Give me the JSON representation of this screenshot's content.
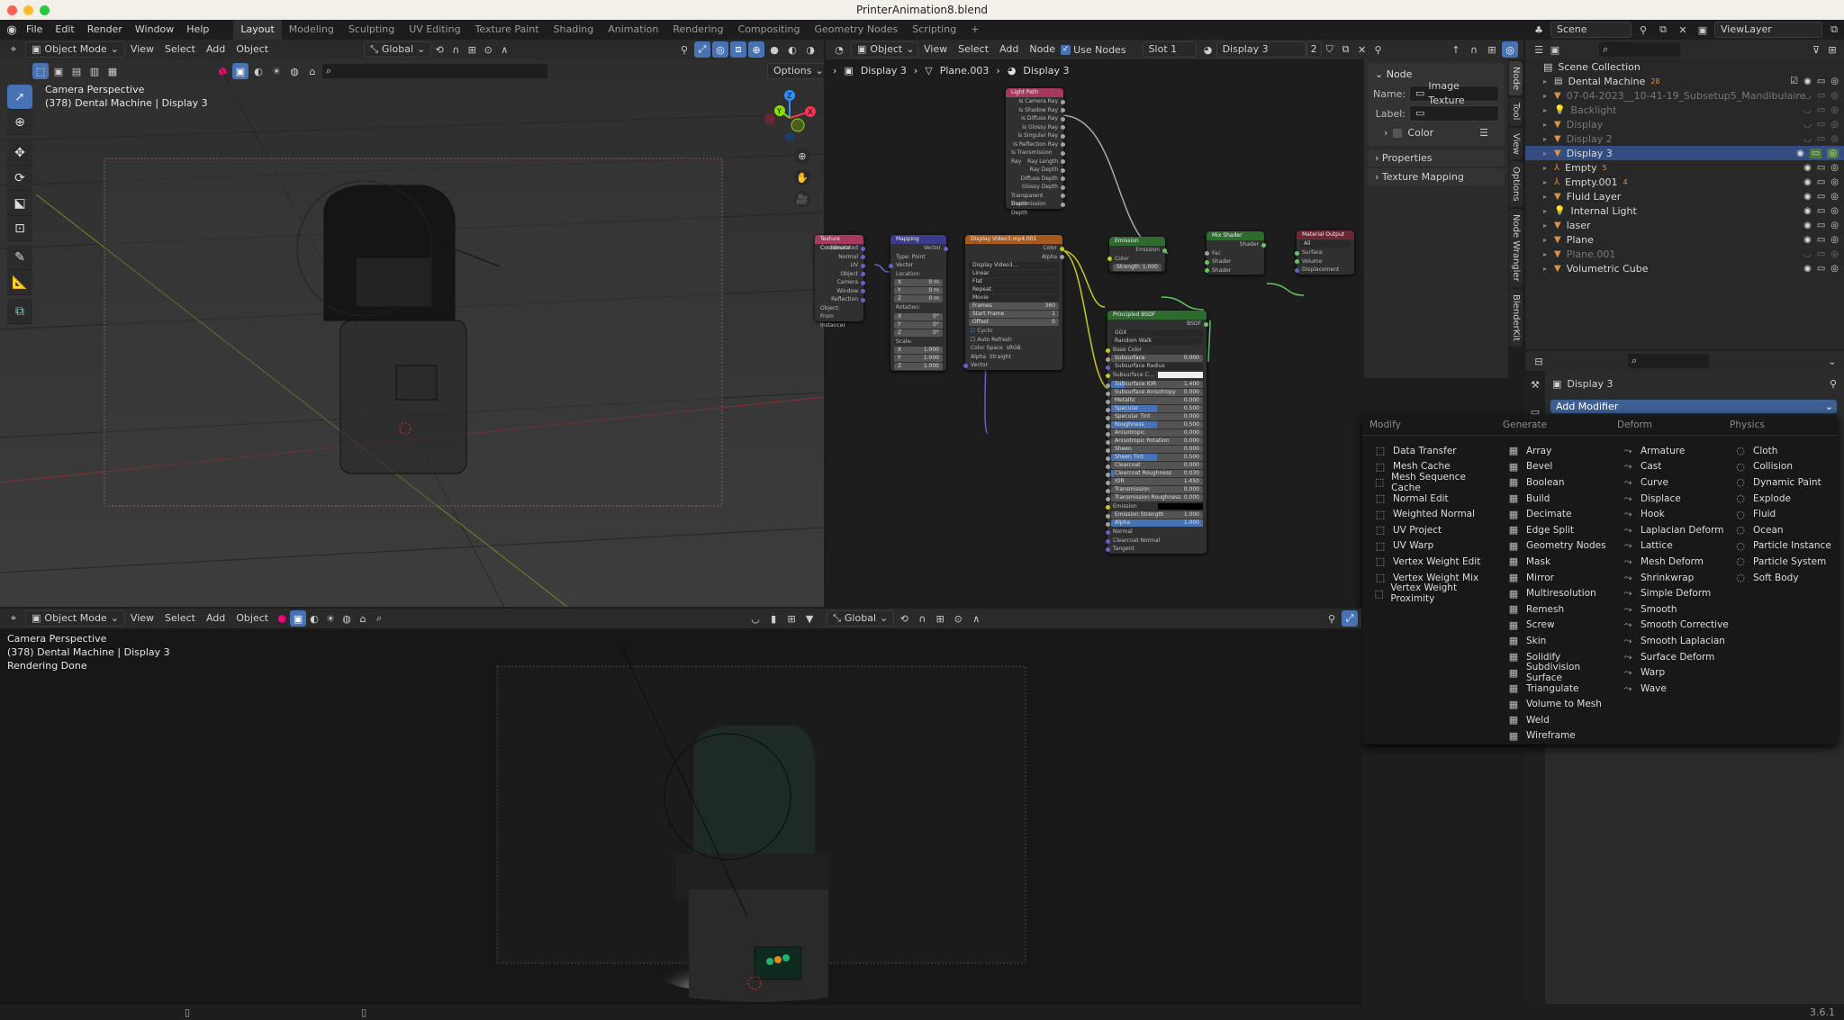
{
  "window": {
    "title": "PrinterAnimation8.blend",
    "version": "3.6.1"
  },
  "menubar": [
    "File",
    "Edit",
    "Render",
    "Window",
    "Help"
  ],
  "workspaces": [
    {
      "label": "Layout",
      "active": true
    },
    {
      "label": "Modeling"
    },
    {
      "label": "Sculpting"
    },
    {
      "label": "UV Editing"
    },
    {
      "label": "Texture Paint"
    },
    {
      "label": "Shading"
    },
    {
      "label": "Animation"
    },
    {
      "label": "Rendering"
    },
    {
      "label": "Compositing"
    },
    {
      "label": "Geometry Nodes"
    },
    {
      "label": "Scripting"
    },
    {
      "label": "+"
    }
  ],
  "scene": {
    "name": "Scene",
    "view_layer": "ViewLayer"
  },
  "viewport_top": {
    "mode": "Object Mode",
    "menus": [
      "View",
      "Select",
      "Add",
      "Object"
    ],
    "orientation": "Global",
    "options": "Options",
    "overlay_lines": [
      "Camera Perspective",
      "(378) Dental Machine | Display 3"
    ],
    "gizmo_axes": [
      "X",
      "Y",
      "Z"
    ]
  },
  "viewport_bottom": {
    "mode": "Object Mode",
    "menus": [
      "View",
      "Select",
      "Add",
      "Object"
    ],
    "orientation": "Global",
    "overlay_lines": [
      "Camera Perspective",
      "(378) Dental Machine | Display 3",
      "Rendering Done"
    ]
  },
  "node_editor": {
    "type": "Object",
    "menus": [
      "View",
      "Select",
      "Add",
      "Node"
    ],
    "use_nodes_label": "Use Nodes",
    "use_nodes": true,
    "slot": "Slot 1",
    "material": "Display 3",
    "users": "2",
    "breadcrumb": [
      "Display 3",
      "Plane.003",
      "Display 3"
    ],
    "nodes": {
      "light_path": {
        "title": "Light Path",
        "outputs": [
          "Is Camera Ray",
          "Is Shadow Ray",
          "Is Diffuse Ray",
          "Is Glossy Ray",
          "Is Singular Ray",
          "Is Reflection Ray",
          "Is Transmission Ray",
          "Ray Length",
          "Ray Depth",
          "Diffuse Depth",
          "Glossy Depth",
          "Transparent Depth",
          "Transmission Depth"
        ]
      },
      "tex_coord": {
        "title": "Texture Coordinate",
        "outputs": [
          "Generated",
          "Normal",
          "UV",
          "Object",
          "Camera",
          "Window",
          "Reflection"
        ],
        "object_label": "Object:",
        "from_instancer": "From Instancer"
      },
      "mapping": {
        "title": "Mapping",
        "output": "Vector",
        "type_label": "Type:",
        "type": "Point",
        "vector": "Vector",
        "location": "Location:",
        "loc": [
          [
            "X",
            "0 m"
          ],
          [
            "Y",
            "0 m"
          ],
          [
            "Z",
            "0 m"
          ]
        ],
        "rotation": "Rotation:",
        "rot": [
          [
            "X",
            "0°"
          ],
          [
            "Y",
            "0°"
          ],
          [
            "Z",
            "0°"
          ]
        ],
        "scale": "Scale:",
        "scl": [
          [
            "X",
            "1.000"
          ],
          [
            "Y",
            "1.000"
          ],
          [
            "Z",
            "1.000"
          ]
        ]
      },
      "image": {
        "title": "Display Video3.mp4.001",
        "outputs": [
          "Color",
          "Alpha"
        ],
        "image": "Display Video3...",
        "interp": "Linear",
        "proj": "Flat",
        "ext": "Repeat",
        "source": "Movie",
        "frames": [
          "Frames",
          "360"
        ],
        "start": [
          "Start Frame",
          "1"
        ],
        "offset": [
          "Offset",
          "0"
        ],
        "cyclic": "Cyclic",
        "auto_refresh": "Auto Refresh",
        "color_space_label": "Color Space",
        "color_space": "sRGB",
        "alpha_label": "Alpha",
        "alpha": "Straight",
        "vector": "Vector"
      },
      "emission": {
        "title": "Emission",
        "output": "Emission",
        "color": "Color",
        "strength": [
          "Strength",
          "1.000"
        ]
      },
      "mix": {
        "title": "Mix Shader",
        "output": "Shader",
        "inputs": [
          "Fac",
          "Shader",
          "Shader"
        ]
      },
      "output": {
        "title": "Material Output",
        "target": "All",
        "inputs": [
          "Surface",
          "Volume",
          "Displacement"
        ]
      },
      "bsdf": {
        "title": "Principled BSDF",
        "output": "BSDF",
        "dist": "GGX",
        "sss": "Random Walk",
        "rows": [
          {
            "label": "Base Color",
            "kind": "socket"
          },
          {
            "label": "Subsurface",
            "value": "0.000",
            "fill": 0
          },
          {
            "label": "Subsurface Radius",
            "kind": "select"
          },
          {
            "label": "Subsurface C...",
            "kind": "color-white"
          },
          {
            "label": "Subsurface IOR",
            "value": "1.400",
            "fill": 0.15
          },
          {
            "label": "Subsurface Anisotropy",
            "value": "0.000",
            "fill": 0
          },
          {
            "label": "Metallic",
            "value": "0.000",
            "fill": 0
          },
          {
            "label": "Specular",
            "value": "0.500",
            "fill": 0.5
          },
          {
            "label": "Specular Tint",
            "value": "0.000",
            "fill": 0
          },
          {
            "label": "Roughness",
            "value": "0.500",
            "fill": 0.5
          },
          {
            "label": "Anisotropic",
            "value": "0.000",
            "fill": 0
          },
          {
            "label": "Anisotropic Rotation",
            "value": "0.000",
            "fill": 0
          },
          {
            "label": "Sheen",
            "value": "0.000",
            "fill": 0
          },
          {
            "label": "Sheen Tint",
            "value": "0.500",
            "fill": 0.5
          },
          {
            "label": "Clearcoat",
            "value": "0.000",
            "fill": 0
          },
          {
            "label": "Clearcoat Roughness",
            "value": "0.030",
            "fill": 0.03
          },
          {
            "label": "IOR",
            "value": "1.450",
            "fill": 0
          },
          {
            "label": "Transmission",
            "value": "0.000",
            "fill": 0
          },
          {
            "label": "Transmission Roughness",
            "value": "0.000",
            "fill": 0
          },
          {
            "label": "Emission",
            "kind": "color-black"
          },
          {
            "label": "Emission Strength",
            "value": "1.000",
            "fill": 0
          },
          {
            "label": "Alpha",
            "value": "1.000",
            "fill": 1
          },
          {
            "label": "Normal",
            "kind": "socket"
          },
          {
            "label": "Clearcoat Normal",
            "kind": "socket"
          },
          {
            "label": "Tangent",
            "kind": "socket"
          }
        ]
      }
    }
  },
  "sidebar": {
    "panel_title": "Node",
    "name_label": "Name:",
    "name_value": "Image Texture",
    "label_label": "Label:",
    "label_value": "",
    "color": "Color",
    "properties": "Properties",
    "texture_mapping": "Texture Mapping",
    "tabs": [
      "Node",
      "Tool",
      "View",
      "Options",
      "Node Wrangler",
      "BlenderKit"
    ]
  },
  "outliner": {
    "root": "Scene Collection",
    "items": [
      {
        "name": "Dental Machine",
        "type": "collection",
        "extra": "28",
        "dim": false,
        "checked": true
      },
      {
        "name": "07-04-2023__10-41-19_Subsetup5_Mandibulaire",
        "type": "mesh",
        "dim": true
      },
      {
        "name": "Backlight",
        "type": "light",
        "dim": true
      },
      {
        "name": "Display",
        "type": "mesh",
        "dim": true
      },
      {
        "name": "Display 2",
        "type": "mesh",
        "dim": true
      },
      {
        "name": "Display 3",
        "type": "mesh",
        "dim": false,
        "active": true
      },
      {
        "name": "Empty",
        "type": "empty",
        "extra": "5",
        "dim": false
      },
      {
        "name": "Empty.001",
        "type": "empty",
        "extra": "4",
        "dim": false
      },
      {
        "name": "Fluid Layer",
        "type": "mesh",
        "dim": false
      },
      {
        "name": "Internal Light",
        "type": "light",
        "dim": false
      },
      {
        "name": "laser",
        "type": "mesh",
        "dim": false
      },
      {
        "name": "Plane",
        "type": "mesh",
        "dim": false
      },
      {
        "name": "Plane.001",
        "type": "mesh",
        "dim": true
      },
      {
        "name": "Volumetric Cube",
        "type": "mesh",
        "dim": false
      }
    ]
  },
  "properties": {
    "object": "Display 3",
    "add_modifier": "Add Modifier"
  },
  "modifier_menu": {
    "columns": [
      {
        "heading": "Modify",
        "items": [
          "Data Transfer",
          "Mesh Cache",
          "Mesh Sequence Cache",
          "Normal Edit",
          "Weighted Normal",
          "UV Project",
          "UV Warp",
          "Vertex Weight Edit",
          "Vertex Weight Mix",
          "Vertex Weight Proximity"
        ]
      },
      {
        "heading": "Generate",
        "items": [
          "Array",
          "Bevel",
          "Boolean",
          "Build",
          "Decimate",
          "Edge Split",
          "Geometry Nodes",
          "Mask",
          "Mirror",
          "Multiresolution",
          "Remesh",
          "Screw",
          "Skin",
          "Solidify",
          "Subdivision Surface",
          "Triangulate",
          "Volume to Mesh",
          "Weld",
          "Wireframe"
        ]
      },
      {
        "heading": "Deform",
        "items": [
          "Armature",
          "Cast",
          "Curve",
          "Displace",
          "Hook",
          "Laplacian Deform",
          "Lattice",
          "Mesh Deform",
          "Shrinkwrap",
          "Simple Deform",
          "Smooth",
          "Smooth Corrective",
          "Smooth Laplacian",
          "Surface Deform",
          "Warp",
          "Wave"
        ]
      },
      {
        "heading": "Physics",
        "items": [
          "Cloth",
          "Collision",
          "Dynamic Paint",
          "Explode",
          "Fluid",
          "Ocean",
          "Particle Instance",
          "Particle System",
          "Soft Body"
        ]
      }
    ]
  },
  "colors": {
    "accent": "#4772b3",
    "active_green": "#4a7a35",
    "socket_yellow": "#c7c729",
    "socket_green": "#63c763",
    "socket_blue": "#6363c7",
    "socket_gray": "#a1a1a1"
  }
}
